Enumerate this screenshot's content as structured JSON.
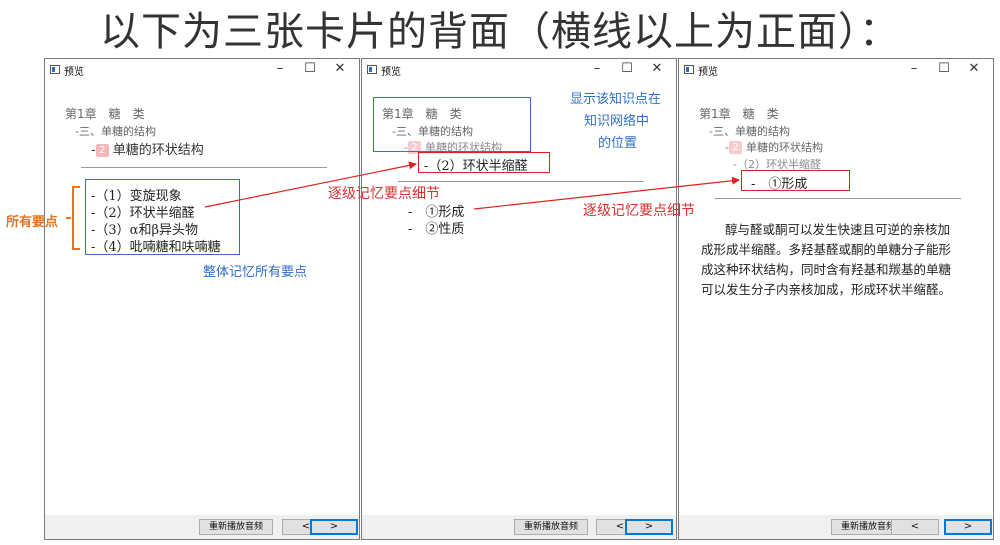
{
  "heading": "以下为三张卡片的背面（横线以上为正面）：",
  "window": {
    "title": "预览",
    "minimize": "–",
    "maximize": "☐",
    "close": "✕",
    "replay_label": "重新播放音频",
    "prev_label": "<",
    "next_label": ">"
  },
  "card1": {
    "chapter": "第1章　糖　类",
    "section": "-三、单糖的结构",
    "badge": "2",
    "topic": "单糖的环状结构",
    "points": [
      "-（1）变旋现象",
      "-（2）环状半缩醛",
      "-（3）α和β异头物",
      "-（4）吡喃糖和呋喃糖"
    ],
    "label_all_points": "所有要点",
    "label_memorize_all": "整体记忆所有要点"
  },
  "card2": {
    "chapter": "第1章　糖　类",
    "section": "-三、单糖的结构",
    "badge": "2",
    "topic": "单糖的环状结构",
    "current": "-（2）环状半缩醛",
    "details": [
      "-　①形成",
      "-　②性质"
    ],
    "label_position": [
      "显示该知识点在",
      "知识网络中",
      "的位置"
    ],
    "label_progressive": "逐级记忆要点细节"
  },
  "card3": {
    "chapter": "第1章　糖　类",
    "section": "-三、单糖的结构",
    "badge": "2",
    "topic": "单糖的环状结构",
    "parent": "-（2）环状半缩醛",
    "current": "-　①形成",
    "paragraph": [
      "醇与醛或酮可以发生快速且可逆的亲核加",
      "成形成半缩醛。多羟基醛或酮的单糖分子能形",
      "成这种环状结构，同时含有羟基和羰基的单糖",
      "可以发生分子内亲核加成，形成环状半缩醛。"
    ],
    "label_progressive": "逐级记忆要点细节"
  },
  "colors": {
    "annotation_blue": "#2f6ec8",
    "annotation_red": "#d93030",
    "annotation_orange": "#e8731a",
    "badge_pink": "#f4b6b6"
  }
}
